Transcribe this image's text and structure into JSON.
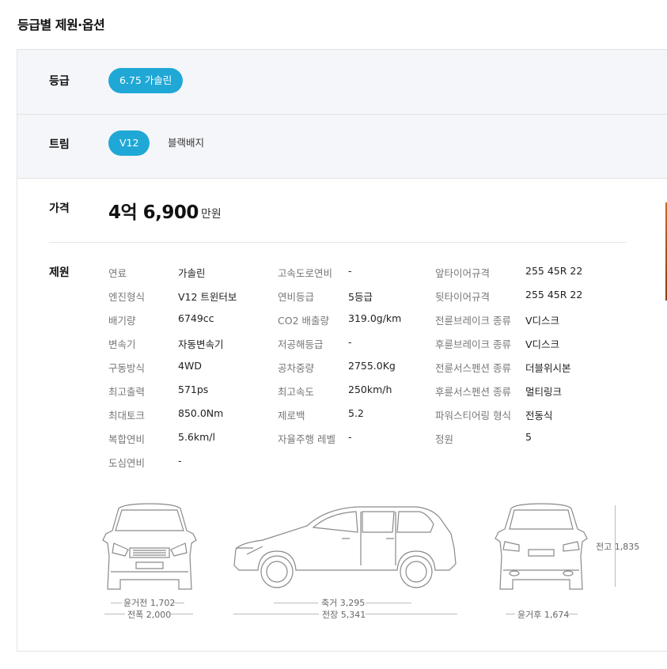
{
  "page_title": "등급별 제원·옵션",
  "grade": {
    "label": "등급",
    "options": [
      "6.75 가솔린"
    ],
    "selected": "6.75 가솔린"
  },
  "trim": {
    "label": "트림",
    "options": [
      "V12",
      "블랙배지"
    ],
    "selected": "V12"
  },
  "price": {
    "label": "가격",
    "value": "4억 6,900",
    "unit": "만원"
  },
  "specs": {
    "label": "제원",
    "col1": [
      {
        "k": "연료",
        "v": "가솔린"
      },
      {
        "k": "엔진형식",
        "v": "V12 트윈터보"
      },
      {
        "k": "배기량",
        "v": "6749cc"
      },
      {
        "k": "변속기",
        "v": "자동변속기"
      },
      {
        "k": "구동방식",
        "v": "4WD"
      },
      {
        "k": "최고출력",
        "v": "571ps"
      },
      {
        "k": "최대토크",
        "v": "850.0Nm"
      },
      {
        "k": "복합연비",
        "v": "5.6km/l"
      },
      {
        "k": "도심연비",
        "v": "-"
      }
    ],
    "col2": [
      {
        "k": "고속도로연비",
        "v": "-"
      },
      {
        "k": "연비등급",
        "v": "5등급"
      },
      {
        "k": "CO2 배출량",
        "v": "319.0g/km"
      },
      {
        "k": "저공해등급",
        "v": "-"
      },
      {
        "k": "공차중량",
        "v": "2755.0Kg"
      },
      {
        "k": "최고속도",
        "v": "250km/h"
      },
      {
        "k": "제로백",
        "v": "5.2"
      },
      {
        "k": "자율주행 레벨",
        "v": "-"
      }
    ],
    "col3": [
      {
        "k": "앞타이어규격",
        "v": "255 45R 22"
      },
      {
        "k": "뒷타이어규격",
        "v": "255 45R 22"
      },
      {
        "k": "전륜브레이크 종류",
        "v": "V디스크"
      },
      {
        "k": "후륜브레이크 종류",
        "v": "V디스크"
      },
      {
        "k": "전륜서스펜션 종류",
        "v": "더블위시본"
      },
      {
        "k": "후륜서스펜션 종류",
        "v": "멀티링크"
      },
      {
        "k": "파워스티어링 형식",
        "v": "전동식"
      },
      {
        "k": "정원",
        "v": "5"
      }
    ]
  },
  "dimensions": {
    "front_track": "윤거전 1,702",
    "width": "전폭 2,000",
    "wheelbase": "축거 3,295",
    "length": "전장 5,341",
    "height": "전고 1,835",
    "rear_track": "윤거후 1,674"
  }
}
